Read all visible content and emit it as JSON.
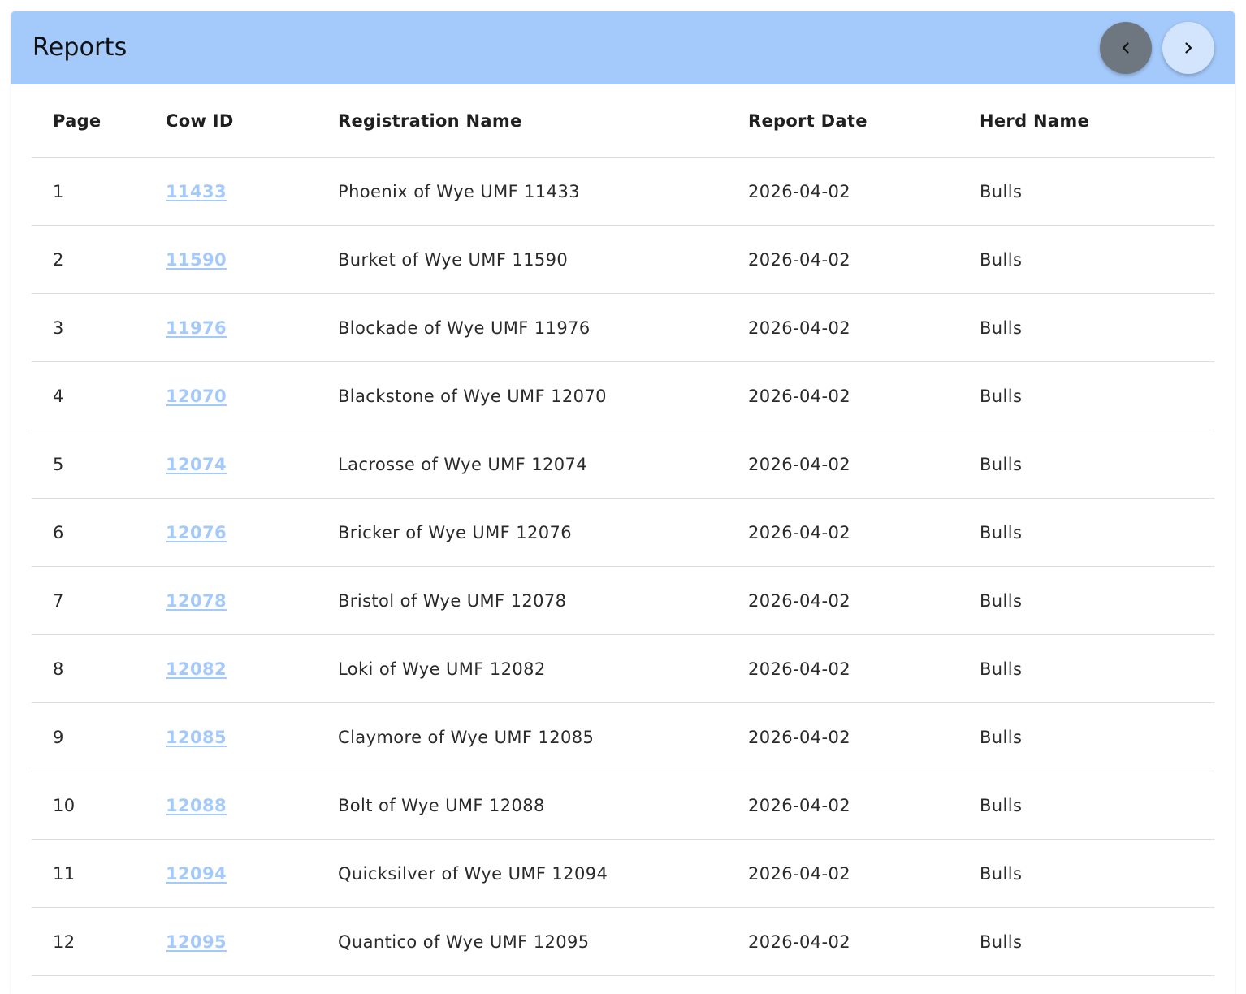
{
  "header": {
    "title": "Reports",
    "accent_color": "#a4c9fb",
    "prev_icon": "chevron-left-icon",
    "next_icon": "chevron-right-icon"
  },
  "table": {
    "columns": [
      "Page",
      "Cow ID",
      "Registration Name",
      "Report Date",
      "Herd Name"
    ],
    "link_color": "#a4c9fb",
    "rows": [
      {
        "page": "1",
        "cow_id": "11433",
        "registration_name": "Phoenix of Wye UMF 11433",
        "report_date": "2026-04-02",
        "herd_name": "Bulls"
      },
      {
        "page": "2",
        "cow_id": "11590",
        "registration_name": "Burket of Wye UMF 11590",
        "report_date": "2026-04-02",
        "herd_name": "Bulls"
      },
      {
        "page": "3",
        "cow_id": "11976",
        "registration_name": "Blockade of Wye UMF 11976",
        "report_date": "2026-04-02",
        "herd_name": "Bulls"
      },
      {
        "page": "4",
        "cow_id": "12070",
        "registration_name": "Blackstone of Wye UMF 12070",
        "report_date": "2026-04-02",
        "herd_name": "Bulls"
      },
      {
        "page": "5",
        "cow_id": "12074",
        "registration_name": "Lacrosse of Wye UMF 12074",
        "report_date": "2026-04-02",
        "herd_name": "Bulls"
      },
      {
        "page": "6",
        "cow_id": "12076",
        "registration_name": "Bricker of Wye UMF 12076",
        "report_date": "2026-04-02",
        "herd_name": "Bulls"
      },
      {
        "page": "7",
        "cow_id": "12078",
        "registration_name": "Bristol of Wye UMF 12078",
        "report_date": "2026-04-02",
        "herd_name": "Bulls"
      },
      {
        "page": "8",
        "cow_id": "12082",
        "registration_name": "Loki of Wye UMF 12082",
        "report_date": "2026-04-02",
        "herd_name": "Bulls"
      },
      {
        "page": "9",
        "cow_id": "12085",
        "registration_name": "Claymore of Wye UMF 12085",
        "report_date": "2026-04-02",
        "herd_name": "Bulls"
      },
      {
        "page": "10",
        "cow_id": "12088",
        "registration_name": "Bolt of Wye UMF 12088",
        "report_date": "2026-04-02",
        "herd_name": "Bulls"
      },
      {
        "page": "11",
        "cow_id": "12094",
        "registration_name": "Quicksilver of Wye UMF 12094",
        "report_date": "2026-04-02",
        "herd_name": "Bulls"
      },
      {
        "page": "12",
        "cow_id": "12095",
        "registration_name": "Quantico of Wye UMF 12095",
        "report_date": "2026-04-02",
        "herd_name": "Bulls"
      }
    ]
  }
}
